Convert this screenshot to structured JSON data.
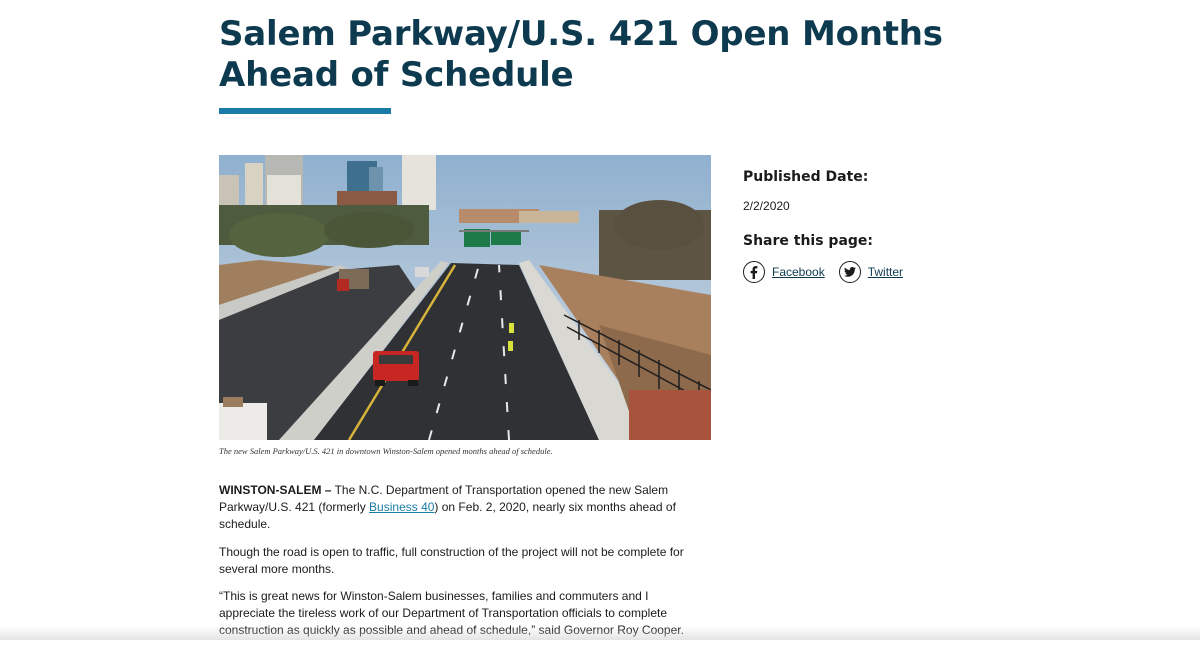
{
  "article": {
    "title": "Salem Parkway/U.S. 421 Open Months Ahead of Schedule",
    "photo_caption": "The new Salem Parkway/U.S. 421 in downtown Winston-Salem opened months ahead of schedule.",
    "dateline": "WINSTON-SALEM –",
    "p1_before": " The N.C. Department of Transportation opened the new Salem Parkway/U.S. 421 (formerly ",
    "p1_link": "Business 40",
    "p1_after": ") on Feb. 2, 2020, nearly six months ahead of schedule.",
    "p2": "Though the road is open to traffic, full construction of the project will not be complete for several more months.",
    "p3": "“This is great news for Winston-Salem businesses, families and commuters and I appreciate the tireless work of our Department of Transportation officials to complete construction as quickly as possible and ahead of schedule,” said Governor Roy Cooper."
  },
  "sidebar": {
    "published_label": "Published Date:",
    "published_date": "2/2/2020",
    "share_label": "Share this page:",
    "facebook_label": "Facebook",
    "facebook_icon": "facebook-icon",
    "twitter_label": "Twitter",
    "twitter_icon": "twitter-icon"
  },
  "colors": {
    "title": "#0d3a4f",
    "accent": "#1a7ba6",
    "link": "#1a7ba6"
  }
}
